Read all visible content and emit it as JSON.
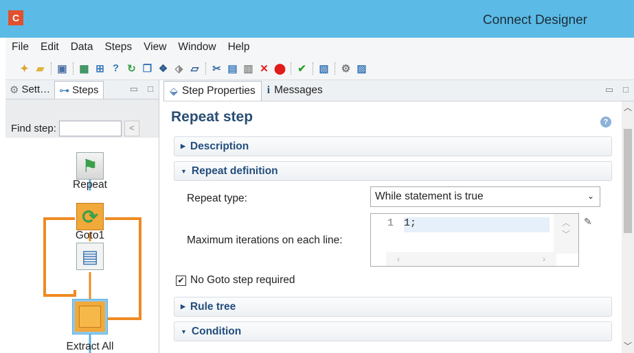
{
  "window": {
    "logo": "C",
    "title": "Connect Designer"
  },
  "menu": [
    "File",
    "Edit",
    "Data",
    "Steps",
    "View",
    "Window",
    "Help"
  ],
  "toolbar": {
    "icons": [
      "new-icon",
      "open-icon",
      "save-icon",
      "save-all-icon",
      "step-icon",
      "hierarchy-icon",
      "help-icon",
      "refresh-icon",
      "copy-icon",
      "group-icon",
      "record-icon",
      "script-icon",
      "cut-icon",
      "paste-icon",
      "clear-icon",
      "delete-icon",
      "stop-icon",
      "validate-icon",
      "export-icon",
      "settings-icon",
      "document-icon"
    ]
  },
  "left_panel": {
    "tabs": [
      {
        "label": "Sett…",
        "icon": "gear-icon"
      },
      {
        "label": "Steps",
        "icon": "steps-icon"
      }
    ],
    "find_label": "Find step:",
    "find_value": "",
    "find_button": "<"
  },
  "flow": {
    "nodes": [
      {
        "label": "Repeat",
        "icon": "flag-icon"
      },
      {
        "label": "Goto1",
        "icon": "goto-icon"
      },
      {
        "label": "",
        "icon": "records-icon"
      },
      {
        "label": "Extract All",
        "icon": "extract-icon"
      }
    ],
    "loop_color": "#ef8a22",
    "link_color": "#5bb0e0"
  },
  "right_panel": {
    "tabs": [
      {
        "label": "Step Properties",
        "icon": "tag-icon"
      },
      {
        "label": "Messages",
        "icon": "info-icon"
      }
    ]
  },
  "props": {
    "title": "Repeat step",
    "sections": {
      "description": "Description",
      "repeat_definition": "Repeat definition",
      "rule_tree": "Rule tree",
      "condition": "Condition"
    },
    "repeat_type_label": "Repeat type:",
    "repeat_type_value": "While statement is true",
    "max_iter_label": "Maximum iterations on each line:",
    "editor": {
      "line_number": "1",
      "code": "1;"
    },
    "no_goto_label": "No Goto step required",
    "no_goto_checked": true
  }
}
